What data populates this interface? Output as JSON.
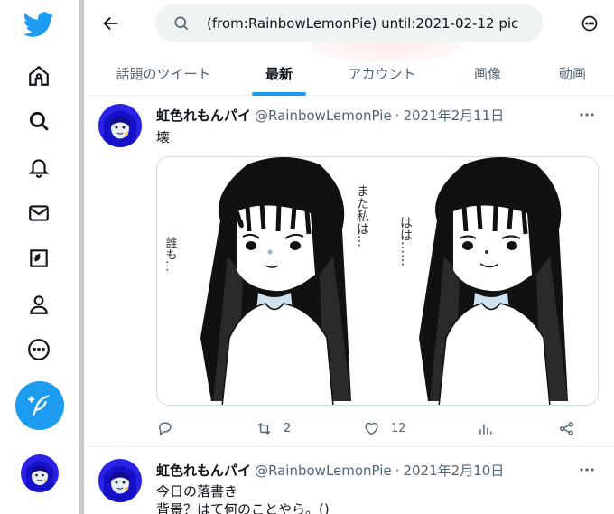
{
  "nav": {
    "items": [
      {
        "name": "twitter-logo-icon"
      },
      {
        "name": "home-icon"
      },
      {
        "name": "explore-search-icon"
      },
      {
        "name": "notifications-bell-icon"
      },
      {
        "name": "messages-envelope-icon"
      },
      {
        "name": "bookmarks-icon"
      },
      {
        "name": "profile-icon"
      },
      {
        "name": "more-circle-icon"
      }
    ],
    "compose_icon": "feather-plus-icon"
  },
  "search": {
    "query": "(from:RainbowLemonPie) until:2021-02-12 pic"
  },
  "tabs": [
    {
      "label": "話題のツイート",
      "active": false
    },
    {
      "label": "最新",
      "active": true
    },
    {
      "label": "アカウント",
      "active": false
    },
    {
      "label": "画像",
      "active": false
    },
    {
      "label": "動画",
      "active": false
    }
  ],
  "tweets": [
    {
      "display_name": "虹色れもんパイ",
      "handle": "@RainbowLemonPie",
      "date": "2021年2月11日",
      "text": "壊",
      "media_text": {
        "left_bubble": "誰も…",
        "middle_bubble": "また私は…",
        "right_bubble": "はは……"
      },
      "reply_count": "",
      "retweet_count": "2",
      "like_count": "12"
    },
    {
      "display_name": "虹色れもんパイ",
      "handle": "@RainbowLemonPie",
      "date": "2021年2月10日",
      "text_line1": "今日の落書き",
      "text_line2": "背景？はて何のことやら。()"
    }
  ],
  "colors": {
    "accent": "#1d9bf0",
    "text": "#0f1419",
    "secondary": "#536471",
    "divider": "#c9c9c9"
  }
}
